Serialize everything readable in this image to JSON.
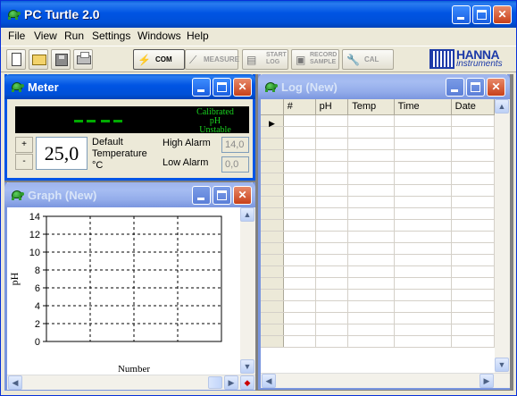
{
  "app": {
    "title": "PC Turtle 2.0"
  },
  "menu": [
    {
      "label": "File"
    },
    {
      "label": "View"
    },
    {
      "label": "Run"
    },
    {
      "label": "Settings"
    },
    {
      "label": "Windows"
    },
    {
      "label": "Help"
    }
  ],
  "toolbar": {
    "com_label": "COM",
    "measure_label": "MEASURE",
    "start_log_label_1": "START",
    "start_log_label_2": "LOG",
    "record_sample_label_1": "RECORD",
    "record_sample_label_2": "SAMPLE",
    "cal_label": "CAL"
  },
  "brand": {
    "line1": "HANNA",
    "line2": "instruments",
    "color": "#1c3aa8"
  },
  "meter": {
    "title": "Meter",
    "reading": "-- --",
    "status_1": "Calibrated",
    "status_2": "pH",
    "status_3": "Unstable",
    "spin_up": "+",
    "spin_down": "-",
    "temperature": "25,0",
    "temp_label_1": "Default",
    "temp_label_2": "Temperature",
    "temp_unit": "°C",
    "high_alarm_label": "High Alarm",
    "high_alarm_value": "14,0",
    "low_alarm_label": "Low Alarm",
    "low_alarm_value": "0,0"
  },
  "graph": {
    "title": "Graph (New)",
    "ylabel": "pH",
    "xlabel": "Number",
    "yticks": [
      "14",
      "12",
      "10",
      "8",
      "6",
      "4",
      "2",
      "0"
    ]
  },
  "log": {
    "title": "Log (New)",
    "columns": [
      "#",
      "pH",
      "Temp",
      "Time",
      "Date"
    ]
  },
  "chart_data": {
    "type": "line",
    "title": "",
    "xlabel": "Number",
    "ylabel": "pH",
    "ylim": [
      0,
      14
    ],
    "yticks": [
      0,
      2,
      4,
      6,
      8,
      10,
      12,
      14
    ],
    "grid": true,
    "series": []
  }
}
